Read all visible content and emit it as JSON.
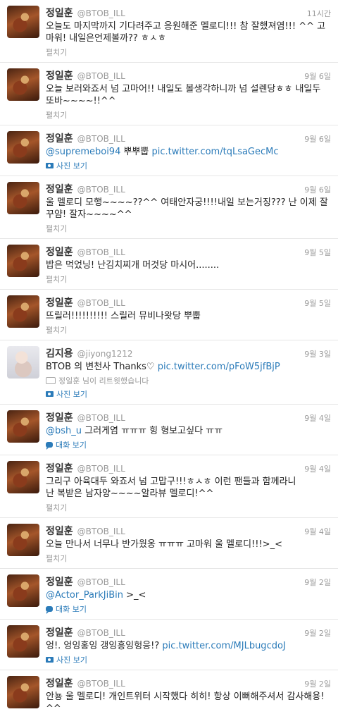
{
  "colors": {
    "link": "#2b7bb9",
    "meta": "#999999",
    "divider": "#e6e6e6",
    "text": "#222222"
  },
  "tweets": [
    {
      "name": "정일훈",
      "handle": "@BTOB_ILL",
      "time": "11시간",
      "text": "오늘도 마지막까지 기다려주고 응원해준 멜로디!!! 참 잘했져염!!! ^^ 고마워! 내일은언제볼까?? ㅎㅅㅎ",
      "action": "펼치기"
    },
    {
      "name": "정일훈",
      "handle": "@BTOB_ILL",
      "time": "9월 6일",
      "text": "오늘 보러와죠서 넘 고마어!! 내일도 볼생각하니까 넘 설렌당ㅎㅎ 내일두 또바~~~~!!^^",
      "action": "펼치기"
    },
    {
      "name": "정일훈",
      "handle": "@BTOB_ILL",
      "time": "9월 6일",
      "mention": "@supremeboi94",
      "text": " 뿌뿌뿝 ",
      "link": "pic.twitter.com/tqLsaGecMc",
      "action": "사진 보기"
    },
    {
      "name": "정일훈",
      "handle": "@BTOB_ILL",
      "time": "9월 6일",
      "text": "울 멜로디 모행~~~~??^^ 여태안자궁!!!!내일 보는거징??? 난 이제 잘꾸얌! 잘자~~~~^^",
      "action": "펼치기"
    },
    {
      "name": "정일훈",
      "handle": "@BTOB_ILL",
      "time": "9월 5일",
      "text": "밥은 먹었닝! 난김치찌개 머것당 마시어........",
      "action": "펼치기"
    },
    {
      "name": "정일훈",
      "handle": "@BTOB_ILL",
      "time": "9월 5일",
      "text": "뜨릴러!!!!!!!!!! 스릴러 뮤비나왓당 뿌뿝",
      "action": "펼치기"
    },
    {
      "name": "김지용",
      "handle": "@jiyong1212",
      "time": "9월 3일",
      "text": "BTOB 의 변천사 Thanks♡ ",
      "link": "pic.twitter.com/pFoW5jfBjP",
      "retweet": "정일훈 님이 리트윗했습니다",
      "action": "사진 보기"
    },
    {
      "name": "정일훈",
      "handle": "@BTOB_ILL",
      "time": "9월 4일",
      "mention": "@bsh_u",
      "text": " 그러게염 ㅠㅠㅠ 힝 형보고싶다 ㅠㅠ",
      "action": "대화 보기"
    },
    {
      "name": "정일훈",
      "handle": "@BTOB_ILL",
      "time": "9월 4일",
      "text": "그리구 아육대두 와죠서 넘 고맙구!!!ㅎㅅㅎ 이런 팬들과 함께라니\n난 복받은 남자양~~~~알라뷰 멜로디!^^",
      "action": "펼치기"
    },
    {
      "name": "정일훈",
      "handle": "@BTOB_ILL",
      "time": "9월 4일",
      "text": "오늘 만나서 너무나 반가웠옹 ㅠㅠㅠ 고마워 울 멜로디!!!>_<",
      "action": "펼치기"
    },
    {
      "name": "정일훈",
      "handle": "@BTOB_ILL",
      "time": "9월 2일",
      "mention": "@Actor_ParkJiBin",
      "text": " >_<",
      "action": "대화 보기"
    },
    {
      "name": "정일훈",
      "handle": "@BTOB_ILL",
      "time": "9월 2일",
      "text": "엉!. 엉잉홍잉 갱잉흥잉헝응!? ",
      "link": "pic.twitter.com/MJLbugcdoJ",
      "action": "사진 보기"
    },
    {
      "name": "정일훈",
      "handle": "@BTOB_ILL",
      "time": "9월 2일",
      "text": "안뇽 울 멜로디! 개인트위터 시작했다 히히! 항상 이뻐해주셔서 감사해용!^^",
      "action": ""
    }
  ]
}
